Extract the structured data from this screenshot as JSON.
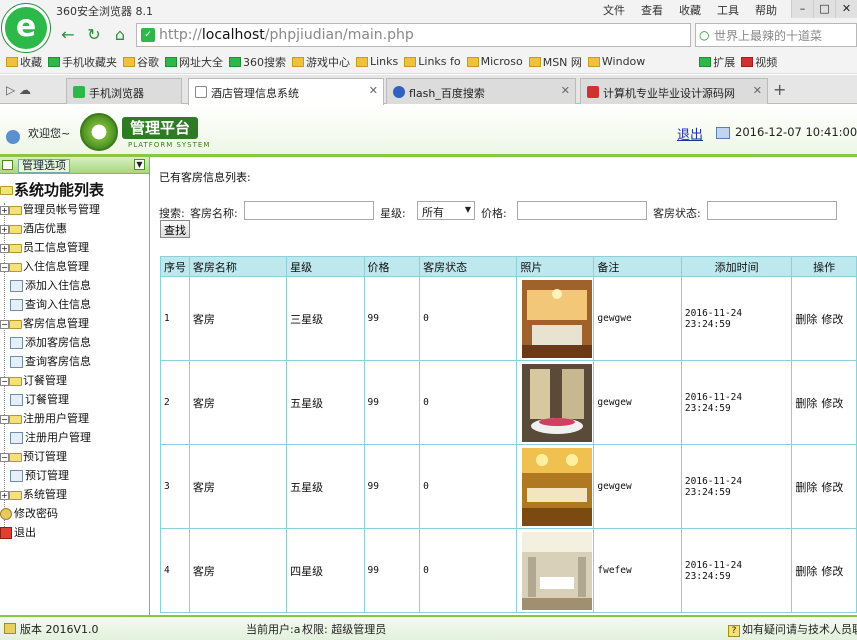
{
  "browser": {
    "window_title": "360安全浏览器 8.1",
    "menu": [
      "文件",
      "查看",
      "收藏",
      "工具",
      "帮助"
    ],
    "url_host": "localhost",
    "url_path": "/phpjiudian/main.php",
    "search_placeholder": "世界上最辣的十道菜",
    "bookmarks": [
      "收藏",
      "手机收藏夹",
      "谷歌",
      "网址大全",
      "360搜索",
      "游戏中心",
      "Links",
      "Links fo",
      "Microso",
      "MSN 网",
      "Window"
    ],
    "extensions": [
      "扩展",
      "视频"
    ],
    "tabs": [
      {
        "label": "手机浏览器"
      },
      {
        "label": "酒店管理信息系统"
      },
      {
        "label": "flash_百度搜索"
      },
      {
        "label": "计算机专业毕业设计源码网"
      }
    ]
  },
  "header": {
    "welcome": "欢迎您~",
    "logo_title": "管理平台",
    "logo_subtitle": "PLATFORM SYSTEM",
    "logout": "退出",
    "datetime": "2016-12-07 10:41:00"
  },
  "sidebar": {
    "header_label": "管理选项",
    "root": "系统功能列表",
    "groups": [
      {
        "label": "管理员帐号管理",
        "expanded": false
      },
      {
        "label": "酒店优惠",
        "expanded": false
      },
      {
        "label": "员工信息管理",
        "expanded": false
      },
      {
        "label": "入住信息管理",
        "expanded": true,
        "children": [
          "添加入住信息",
          "查询入住信息"
        ]
      },
      {
        "label": "客房信息管理",
        "expanded": true,
        "children": [
          "添加客房信息",
          "查询客房信息"
        ]
      },
      {
        "label": "订餐管理",
        "expanded": true,
        "children": [
          "订餐管理"
        ]
      },
      {
        "label": "注册用户管理",
        "expanded": true,
        "children": [
          "注册用户管理"
        ]
      },
      {
        "label": "预订管理",
        "expanded": true,
        "children": [
          "预订管理"
        ]
      },
      {
        "label": "系统管理",
        "expanded": false
      }
    ],
    "leaves": [
      "修改密码",
      "退出"
    ]
  },
  "main": {
    "list_title": "已有客房信息列表:",
    "search": {
      "label": "搜索:",
      "name_label": "客房名称:",
      "star_label": "星级:",
      "star_value": "所有",
      "price_label": "价格:",
      "status_label": "客房状态:",
      "button": "查找"
    },
    "columns": [
      "序号",
      "客房名称",
      "星级",
      "价格",
      "客房状态",
      "照片",
      "备注",
      "添加时间",
      "操作"
    ],
    "rows": [
      {
        "no": "1",
        "name": "客房",
        "star": "三星级",
        "price": "99",
        "status": "0",
        "remark": "gewgwe",
        "time": "2016-11-24 23:24:59",
        "photo": "room-photo-1"
      },
      {
        "no": "2",
        "name": "客房",
        "star": "五星级",
        "price": "99",
        "status": "0",
        "remark": "gewgew",
        "time": "2016-11-24 23:24:59",
        "photo": "room-photo-2"
      },
      {
        "no": "3",
        "name": "客房",
        "star": "五星级",
        "price": "99",
        "status": "0",
        "remark": "gewgew",
        "time": "2016-11-24 23:24:59",
        "photo": "room-photo-3"
      },
      {
        "no": "4",
        "name": "客房",
        "star": "四星级",
        "price": "99",
        "status": "0",
        "remark": "fwefew",
        "time": "2016-11-24 23:24:59",
        "photo": "room-photo-4"
      }
    ],
    "op_delete": "删除",
    "op_edit": "修改"
  },
  "status_bar": {
    "version": "版本 2016V1.0",
    "current_user": "当前用户:a",
    "role": "权限:  超级管理员",
    "help": "如有疑问请与技术人员联"
  }
}
